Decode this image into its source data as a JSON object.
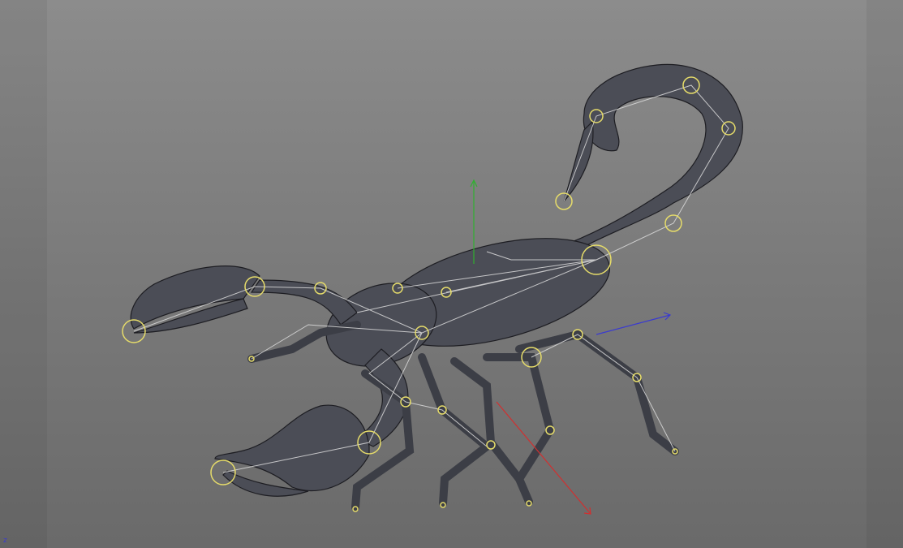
{
  "viewport": {
    "axis_label": "z",
    "colors": {
      "background": "#7c7c7c",
      "mesh": "#4a4c55",
      "wire": "#1e1e22",
      "joint": "#e8e070",
      "bone": "#e0e0e0",
      "axis_x": "#d03030",
      "axis_y": "#30b030",
      "axis_z": "#3030d0"
    }
  }
}
